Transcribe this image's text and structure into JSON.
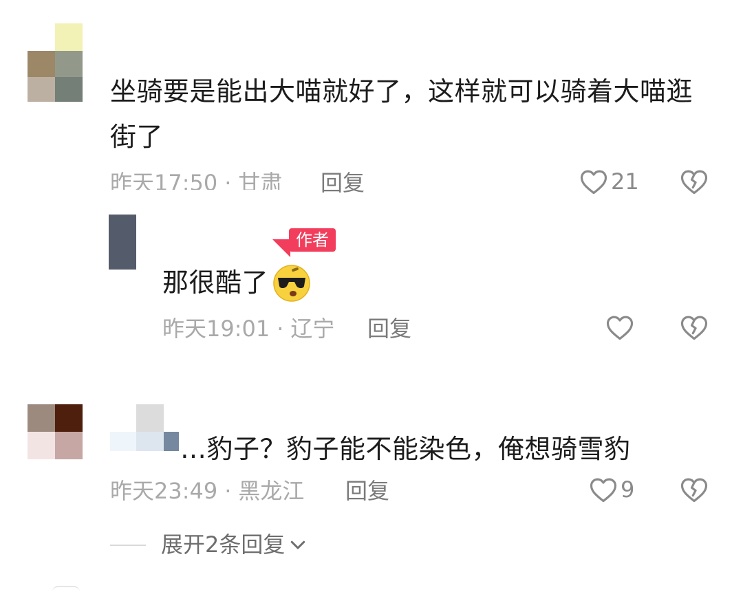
{
  "comments": [
    {
      "text_line1": "坐骑要是能出大喵就好了，这样就可以骑着大喵逛",
      "text_line2": "街了",
      "time": "昨天17:50",
      "location": "甘肃",
      "reply_label": "回复",
      "likes": "21"
    },
    {
      "badge": "作者",
      "text": "那很酷了",
      "emoji": "cool-sunglasses-emoji",
      "time": "昨天19:01",
      "location": "辽宁",
      "reply_label": "回复",
      "likes": ""
    },
    {
      "prefix": "…",
      "text": "豹子？豹子能不能染色，俺想骑雪豹",
      "time": "昨天23:49",
      "location": "黑龙江",
      "reply_label": "回复",
      "likes": "9",
      "expand_label": "展开2条回复"
    }
  ],
  "separator": "·",
  "icons": {
    "like": "heart-outline-icon",
    "dislike": "broken-heart-icon",
    "expand": "chevron-down-icon"
  },
  "colors": {
    "badge": "#f23d5c",
    "meta": "#a9a9a9",
    "text": "#1c1c1c"
  }
}
